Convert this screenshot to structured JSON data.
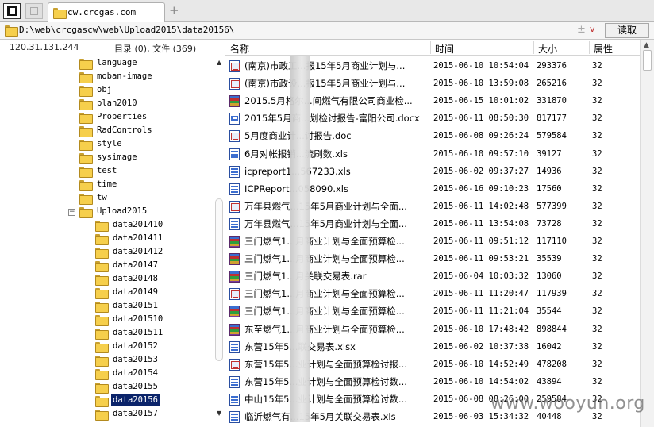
{
  "tab": {
    "label": "cw.crcgas.com",
    "add": "+"
  },
  "address": {
    "path": "D:\\web\\crcgascw\\web\\Upload2015\\data20156\\",
    "plus": "±",
    "dropdown": "v",
    "read_button": "读取"
  },
  "info": {
    "ip": "120.31.131.244",
    "counts": "目录 (0), 文件 (369)"
  },
  "columns": {
    "name": "名称",
    "time": "时间",
    "size": "大小",
    "attr": "属性"
  },
  "tree": [
    {
      "label": "language"
    },
    {
      "label": "moban-image"
    },
    {
      "label": "obj"
    },
    {
      "label": "plan2010"
    },
    {
      "label": "Properties"
    },
    {
      "label": "RadControls"
    },
    {
      "label": "style"
    },
    {
      "label": "sysimage"
    },
    {
      "label": "test"
    },
    {
      "label": "time"
    },
    {
      "label": "tw"
    },
    {
      "label": "Upload2015",
      "expander": "−"
    },
    {
      "label": "data201410"
    },
    {
      "label": "data201411"
    },
    {
      "label": "data201412"
    },
    {
      "label": "data20147"
    },
    {
      "label": "data20148"
    },
    {
      "label": "data20149"
    },
    {
      "label": "data20151"
    },
    {
      "label": "data201510"
    },
    {
      "label": "data201511"
    },
    {
      "label": "data20152"
    },
    {
      "label": "data20153"
    },
    {
      "label": "data20154"
    },
    {
      "label": "data20155"
    },
    {
      "label": "data20156",
      "selected": true
    },
    {
      "label": "data20157"
    }
  ],
  "files": [
    {
      "icon": "doc-red",
      "name": "(南京)市政工...报15年5月商业计划与...",
      "time": "2015-06-10 10:54:04",
      "size": "293376",
      "attr": "32"
    },
    {
      "icon": "doc-red",
      "name": "(南京)市政设...报15年5月商业计划与...",
      "time": "2015-06-10 13:59:08",
      "size": "265216",
      "attr": "32"
    },
    {
      "icon": "rar",
      "name": "2015.5月格尔...间燃气有限公司商业检...",
      "time": "2015-06-15 10:01:02",
      "size": "331870",
      "attr": "32"
    },
    {
      "icon": "doc",
      "name": "2015年5月商...划检讨报告-富阳公司.docx",
      "time": "2015-06-11 08:50:30",
      "size": "817177",
      "attr": "32"
    },
    {
      "icon": "doc-red",
      "name": "5月度商业计...讨报告.doc",
      "time": "2015-06-08 09:26:24",
      "size": "579584",
      "attr": "32"
    },
    {
      "icon": "xls",
      "name": "6月对帐报销...流刷数.xls",
      "time": "2015-06-10 09:57:10",
      "size": "39127",
      "attr": "32"
    },
    {
      "icon": "xls",
      "name": "icpreport1...567233.xls",
      "time": "2015-06-02 09:37:27",
      "size": "14936",
      "attr": "32"
    },
    {
      "icon": "xls",
      "name": "ICPReport...058090.xls",
      "time": "2015-06-16 09:10:23",
      "size": "17560",
      "attr": "32"
    },
    {
      "icon": "doc-red",
      "name": "万年县燃气...15年5月商业计划与全面...",
      "time": "2015-06-11 14:02:48",
      "size": "577399",
      "attr": "32"
    },
    {
      "icon": "xls",
      "name": "万年县燃气...15年5月商业计划与全面...",
      "time": "2015-06-11 13:54:08",
      "size": "73728",
      "attr": "32"
    },
    {
      "icon": "rar",
      "name": "三门燃气1...月商业计划与全面预算检...",
      "time": "2015-06-11 09:51:12",
      "size": "117110",
      "attr": "32"
    },
    {
      "icon": "rar",
      "name": "三门燃气1...月商业计划与全面预算检...",
      "time": "2015-06-11 09:53:21",
      "size": "35539",
      "attr": "32"
    },
    {
      "icon": "rar",
      "name": "三门燃气1...月关联交易表.rar",
      "time": "2015-06-04 10:03:32",
      "size": "13060",
      "attr": "32"
    },
    {
      "icon": "doc-red",
      "name": "三门燃气1...月商业计划与全面预算检...",
      "time": "2015-06-11 11:20:47",
      "size": "117939",
      "attr": "32"
    },
    {
      "icon": "rar",
      "name": "三门燃气1...月商业计划与全面预算检...",
      "time": "2015-06-11 11:21:04",
      "size": "35544",
      "attr": "32"
    },
    {
      "icon": "rar",
      "name": "东至燃气1...月商业计划与全面预算检...",
      "time": "2015-06-10 17:48:42",
      "size": "898844",
      "attr": "32"
    },
    {
      "icon": "xls",
      "name": "东营15年5...联交易表.xlsx",
      "time": "2015-06-02 10:37:38",
      "size": "16042",
      "attr": "32"
    },
    {
      "icon": "doc-red",
      "name": "东营15年5...业计划与全面预算检讨报...",
      "time": "2015-06-10 14:52:49",
      "size": "478208",
      "attr": "32"
    },
    {
      "icon": "xls",
      "name": "东营15年5...业计划与全面预算检讨数...",
      "time": "2015-06-10 14:54:02",
      "size": "43894",
      "attr": "32"
    },
    {
      "icon": "xls",
      "name": "中山15年5...业计划与全面预算检讨数...",
      "time": "2015-06-08 08:26:00",
      "size": "259584",
      "attr": "32"
    },
    {
      "icon": "xls",
      "name": "临沂燃气有...15年5月关联交易表.xls",
      "time": "2015-06-03 15:34:32",
      "size": "40448",
      "attr": "32"
    }
  ],
  "watermark": "www.wooyun.org"
}
